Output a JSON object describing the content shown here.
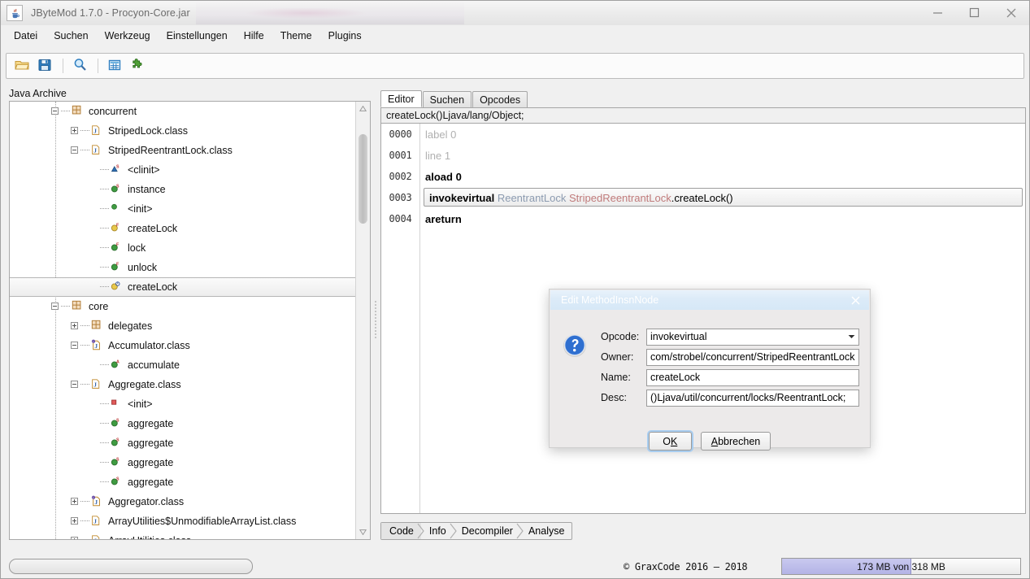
{
  "window": {
    "title": "JByteMod 1.7.0 - Procyon-Core.jar",
    "app_icon": "java-coffee-cup-icon",
    "minimize_label": "–",
    "maximize_label": "□",
    "close_label": "×"
  },
  "menubar": {
    "items": [
      {
        "label": "Datei"
      },
      {
        "label": "Suchen"
      },
      {
        "label": "Werkzeug"
      },
      {
        "label": "Einstellungen"
      },
      {
        "label": "Hilfe"
      },
      {
        "label": "Theme"
      },
      {
        "label": "Plugins"
      }
    ]
  },
  "toolbar": {
    "buttons": [
      {
        "icon": "open-folder-icon",
        "label": ""
      },
      {
        "icon": "save-disk-icon",
        "label": ""
      },
      {
        "icon": "search-magnifier-icon",
        "label": ""
      },
      {
        "icon": "table-grid-icon",
        "label": ""
      },
      {
        "icon": "plugin-puzzle-icon",
        "label": ""
      }
    ]
  },
  "left_panel": {
    "label": "Java Archive",
    "tree": [
      {
        "indent": 1,
        "expander": "minus",
        "icon": "package-icon",
        "label": "concurrent"
      },
      {
        "indent": 2,
        "expander": "plus",
        "icon": "class-icon",
        "label": "StripedLock.class"
      },
      {
        "indent": 2,
        "expander": "minus",
        "icon": "class-icon",
        "label": "StripedReentrantLock.class"
      },
      {
        "indent": 3,
        "expander": "none",
        "icon": "static-init-icon",
        "label": "<clinit>"
      },
      {
        "indent": 3,
        "expander": "none",
        "icon": "field-static-icon",
        "label": "instance"
      },
      {
        "indent": 3,
        "expander": "none",
        "icon": "method-icon",
        "label": "<init>"
      },
      {
        "indent": 3,
        "expander": "none",
        "icon": "method-final-yellow-icon",
        "label": "createLock"
      },
      {
        "indent": 3,
        "expander": "none",
        "icon": "method-final-icon",
        "label": "lock"
      },
      {
        "indent": 3,
        "expander": "none",
        "icon": "method-final-icon",
        "label": "unlock"
      },
      {
        "indent": 3,
        "expander": "none",
        "icon": "method-synthetic-icon",
        "label": "createLock",
        "selected": true
      },
      {
        "indent": 1,
        "expander": "minus",
        "icon": "package-icon",
        "label": "core"
      },
      {
        "indent": 2,
        "expander": "plus",
        "icon": "package-icon",
        "label": "delegates"
      },
      {
        "indent": 2,
        "expander": "minus",
        "icon": "interface-class-icon",
        "label": "Accumulator.class"
      },
      {
        "indent": 3,
        "expander": "none",
        "icon": "method-abstract-icon",
        "label": "accumulate"
      },
      {
        "indent": 2,
        "expander": "minus",
        "icon": "class-icon",
        "label": "Aggregate.class"
      },
      {
        "indent": 3,
        "expander": "none",
        "icon": "private-init-icon",
        "label": "<init>"
      },
      {
        "indent": 3,
        "expander": "none",
        "icon": "field-static-icon",
        "label": "aggregate"
      },
      {
        "indent": 3,
        "expander": "none",
        "icon": "field-static-icon",
        "label": "aggregate"
      },
      {
        "indent": 3,
        "expander": "none",
        "icon": "field-static-icon",
        "label": "aggregate"
      },
      {
        "indent": 3,
        "expander": "none",
        "icon": "field-static-icon",
        "label": "aggregate"
      },
      {
        "indent": 2,
        "expander": "plus",
        "icon": "interface-class-icon",
        "label": "Aggregator.class"
      },
      {
        "indent": 2,
        "expander": "plus",
        "icon": "class-icon",
        "label": "ArrayUtilities$UnmodifiableArrayList.class"
      },
      {
        "indent": 2,
        "expander": "plus",
        "icon": "class-icon",
        "label": "ArrayUtilities.class"
      }
    ]
  },
  "editor": {
    "tabs": [
      {
        "label": "Editor",
        "active": true
      },
      {
        "label": "Suchen",
        "active": false
      },
      {
        "label": "Opcodes",
        "active": false
      }
    ],
    "signature": "createLock()Ljava/lang/Object;",
    "rows": [
      {
        "num": "0000",
        "style": "dim",
        "text": "label 0"
      },
      {
        "num": "0001",
        "style": "dim",
        "text": "line 1"
      },
      {
        "num": "0002",
        "style": "bold",
        "text": "aload 0"
      },
      {
        "num": "0003",
        "style": "selected",
        "text": "invokevirtual ReentrantLock StripedReentrantLock.createLock()",
        "tokens": [
          {
            "t": "invokevirtual",
            "cls": "tk-op"
          },
          {
            "t": " ",
            "cls": "tk-rest"
          },
          {
            "t": "ReentrantLock",
            "cls": "tk-type"
          },
          {
            "t": " ",
            "cls": "tk-rest"
          },
          {
            "t": "StripedReentrantLock",
            "cls": "tk-owner"
          },
          {
            "t": ".createLock()",
            "cls": "tk-rest"
          }
        ]
      },
      {
        "num": "0004",
        "style": "bold",
        "text": "areturn"
      }
    ],
    "bottom_tabs": [
      {
        "label": "Code",
        "active": true
      },
      {
        "label": "Info",
        "active": false
      },
      {
        "label": "Decompiler",
        "active": false
      },
      {
        "label": "Analyse",
        "active": false
      }
    ]
  },
  "status_bar": {
    "field_value": "",
    "copyright": "© GraxCode 2016 – 2018",
    "memory_text": "173 MB von 318 MB",
    "memory_used_mb": 173,
    "memory_total_mb": 318,
    "memory_percent": 54
  },
  "dialog": {
    "title": "Edit MethodInsnNode",
    "close_label": "×",
    "icon": "question-mark-icon",
    "fields": [
      {
        "label": "Opcode:",
        "type": "combo",
        "value": "invokevirtual"
      },
      {
        "label": "Owner:",
        "type": "text",
        "value": "com/strobel/concurrent/StripedReentrantLock"
      },
      {
        "label": "Name:",
        "type": "text",
        "value": "createLock"
      },
      {
        "label": "Desc:",
        "type": "text",
        "value": "()Ljava/util/concurrent/locks/ReentrantLock;"
      }
    ],
    "ok_label": "OK",
    "ok_mnemonic": "K",
    "cancel_label": "Abbrechen",
    "cancel_mnemonic": "A"
  },
  "colors": {
    "accent_blue": "#3a7fd5",
    "dialog_title_bg": "#dceaf7",
    "memory_fill": "#b3b3e6",
    "type_token": "#8c9bb0",
    "owner_token": "#c07b7b"
  }
}
